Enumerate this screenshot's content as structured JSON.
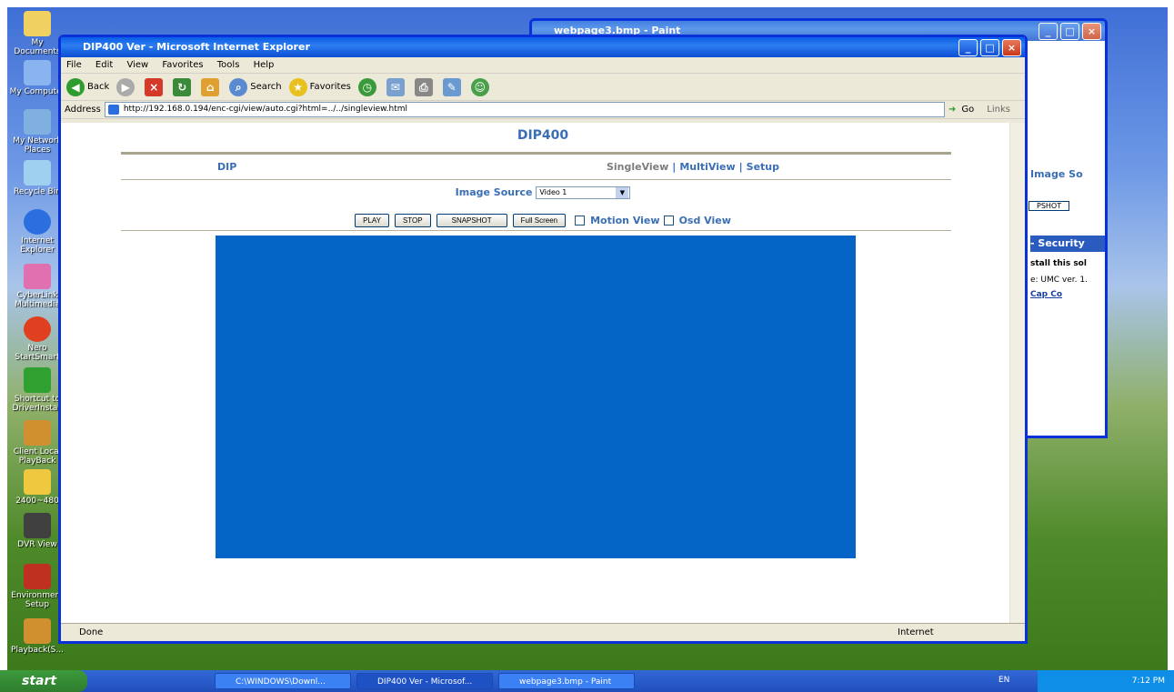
{
  "desktop_icons": [
    {
      "label": "My Documents",
      "color": "#f0d060"
    },
    {
      "label": "My Computer",
      "color": "#8ab4f0"
    },
    {
      "label": "My Network Places",
      "color": "#7fb0e0"
    },
    {
      "label": "Recycle Bin",
      "color": "#9fd0f0"
    },
    {
      "label": "Internet Explorer",
      "color": "#2a6ee0"
    },
    {
      "label": "CyberLink Multimedia",
      "color": "#e070b0"
    },
    {
      "label": "Nero StartSmart",
      "color": "#e04020"
    },
    {
      "label": "Shortcut to DriverInstall",
      "color": "#30a030"
    },
    {
      "label": "Client Local PlayBack",
      "color": "#d09030"
    },
    {
      "label": "2400~480",
      "color": "#f0c840"
    },
    {
      "label": "DVR View",
      "color": "#404040"
    },
    {
      "label": "Environment Setup",
      "color": "#c03020"
    },
    {
      "label": "Playback(S...",
      "color": "#d09030"
    }
  ],
  "paint": {
    "title": "webpage3.bmp - Paint"
  },
  "ie": {
    "title": "DIP400 Ver - Microsoft Internet Explorer",
    "menus": [
      "File",
      "Edit",
      "View",
      "Favorites",
      "Tools",
      "Help"
    ],
    "toolbar": {
      "back": "Back",
      "search": "Search",
      "favorites": "Favorites"
    },
    "address_label": "Address",
    "url": "http://192.168.0.194/enc-cgi/view/auto.cgi?html=../../singleview.html",
    "go": "Go",
    "links": "Links",
    "status_done": "Done",
    "status_zone": "Internet"
  },
  "page": {
    "title": "DIP400",
    "nav_left": "DIP",
    "nav": {
      "single": "SingleView",
      "multi": "MultiView",
      "setup": "Setup",
      "sep": "|"
    },
    "image_source_label": "Image Source",
    "image_source_value": "Video 1",
    "buttons": {
      "play": "PLAY",
      "stop": "STOP",
      "snapshot": "SNAPSHOT",
      "fullscreen": "Full Screen"
    },
    "motion_view": "Motion View",
    "osd_view": "Osd View",
    "video_color": "#0565c6"
  },
  "behind": {
    "image_so": "Image So",
    "pshot": "PSHOT",
    "security": "- Security",
    "install": "stall this sol",
    "umc": "e: UMC ver. 1.",
    "capco": "Cap Co"
  },
  "taskbar": {
    "start": "start",
    "items": [
      "C:\\WINDOWS\\Downl...",
      "DIP400 Ver - Microsof...",
      "webpage3.bmp - Paint"
    ],
    "lang": "EN",
    "time": "7:12 PM"
  }
}
